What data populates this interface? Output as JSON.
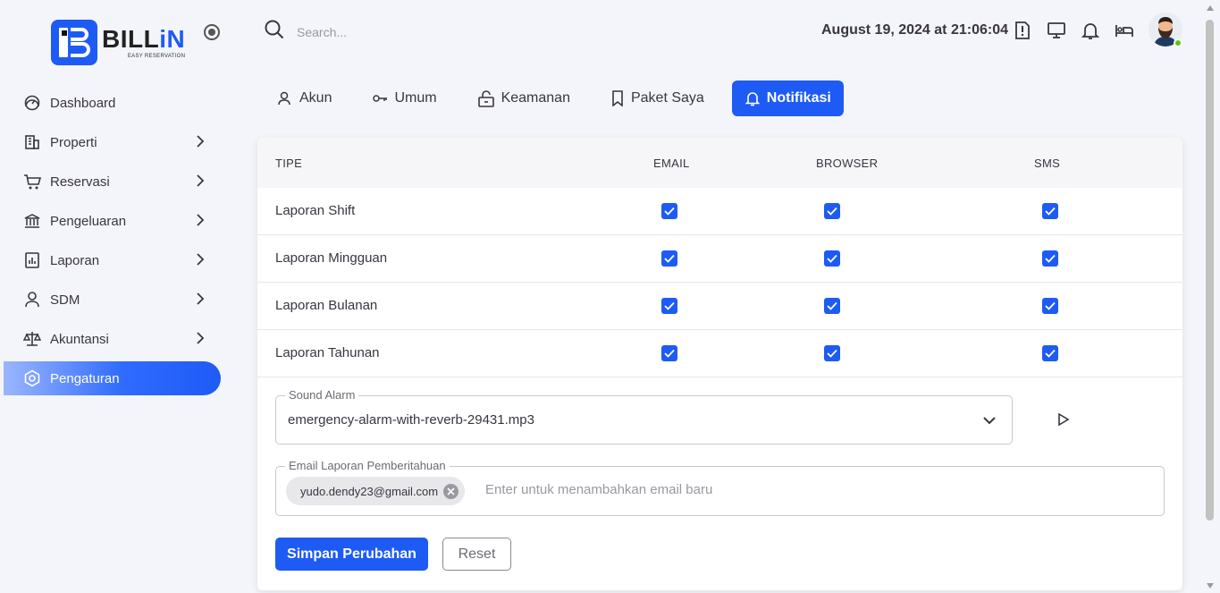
{
  "brand": {
    "name_part1": "BILL",
    "name_part2": "iN",
    "tagline": "EASY RESERVATION",
    "color": "#1e5bf5"
  },
  "sidebar": {
    "items": [
      {
        "label": "Dashboard",
        "icon": "speedometer-icon",
        "has_submenu": false,
        "active": false
      },
      {
        "label": "Properti",
        "icon": "building-icon",
        "has_submenu": true,
        "active": false
      },
      {
        "label": "Reservasi",
        "icon": "cart-icon",
        "has_submenu": true,
        "active": false
      },
      {
        "label": "Pengeluaran",
        "icon": "bank-icon",
        "has_submenu": true,
        "active": false
      },
      {
        "label": "Laporan",
        "icon": "report-icon",
        "has_submenu": true,
        "active": false
      },
      {
        "label": "SDM",
        "icon": "user-icon",
        "has_submenu": true,
        "active": false
      },
      {
        "label": "Akuntansi",
        "icon": "scale-icon",
        "has_submenu": true,
        "active": false
      },
      {
        "label": "Pengaturan",
        "icon": "settings-icon",
        "has_submenu": false,
        "active": true
      }
    ]
  },
  "header": {
    "search_placeholder": "Search...",
    "datetime": "August 19, 2024 at 21:06:04",
    "icons": [
      "report-alert-icon",
      "monitor-icon",
      "bell-icon",
      "bed-icon"
    ],
    "online_color": "#56ca00"
  },
  "tabs": [
    {
      "label": "Akun",
      "icon": "user-outline-icon",
      "active": false
    },
    {
      "label": "Umum",
      "icon": "key-icon",
      "active": false
    },
    {
      "label": "Keamanan",
      "icon": "lock-open-icon",
      "active": false
    },
    {
      "label": "Paket Saya",
      "icon": "bookmark-icon",
      "active": false
    },
    {
      "label": "Notifikasi",
      "icon": "bell-icon",
      "active": true
    }
  ],
  "table": {
    "headers": {
      "type": "TIPE",
      "email": "EMAIL",
      "browser": "BROWSER",
      "sms": "SMS"
    },
    "rows": [
      {
        "label": "Laporan Shift",
        "email": true,
        "browser": true,
        "sms": true
      },
      {
        "label": "Laporan Mingguan",
        "email": true,
        "browser": true,
        "sms": true
      },
      {
        "label": "Laporan Bulanan",
        "email": true,
        "browser": true,
        "sms": true
      },
      {
        "label": "Laporan Tahunan",
        "email": true,
        "browser": true,
        "sms": true
      }
    ]
  },
  "sound_alarm": {
    "label": "Sound Alarm",
    "value": "emergency-alarm-with-reverb-29431.mp3"
  },
  "email_report": {
    "label": "Email Laporan Pemberitahuan",
    "chips": [
      "yudo.dendy23@gmail.com"
    ],
    "placeholder": "Enter untuk menambahkan email baru"
  },
  "actions": {
    "save": "Simpan Perubahan",
    "reset": "Reset"
  }
}
